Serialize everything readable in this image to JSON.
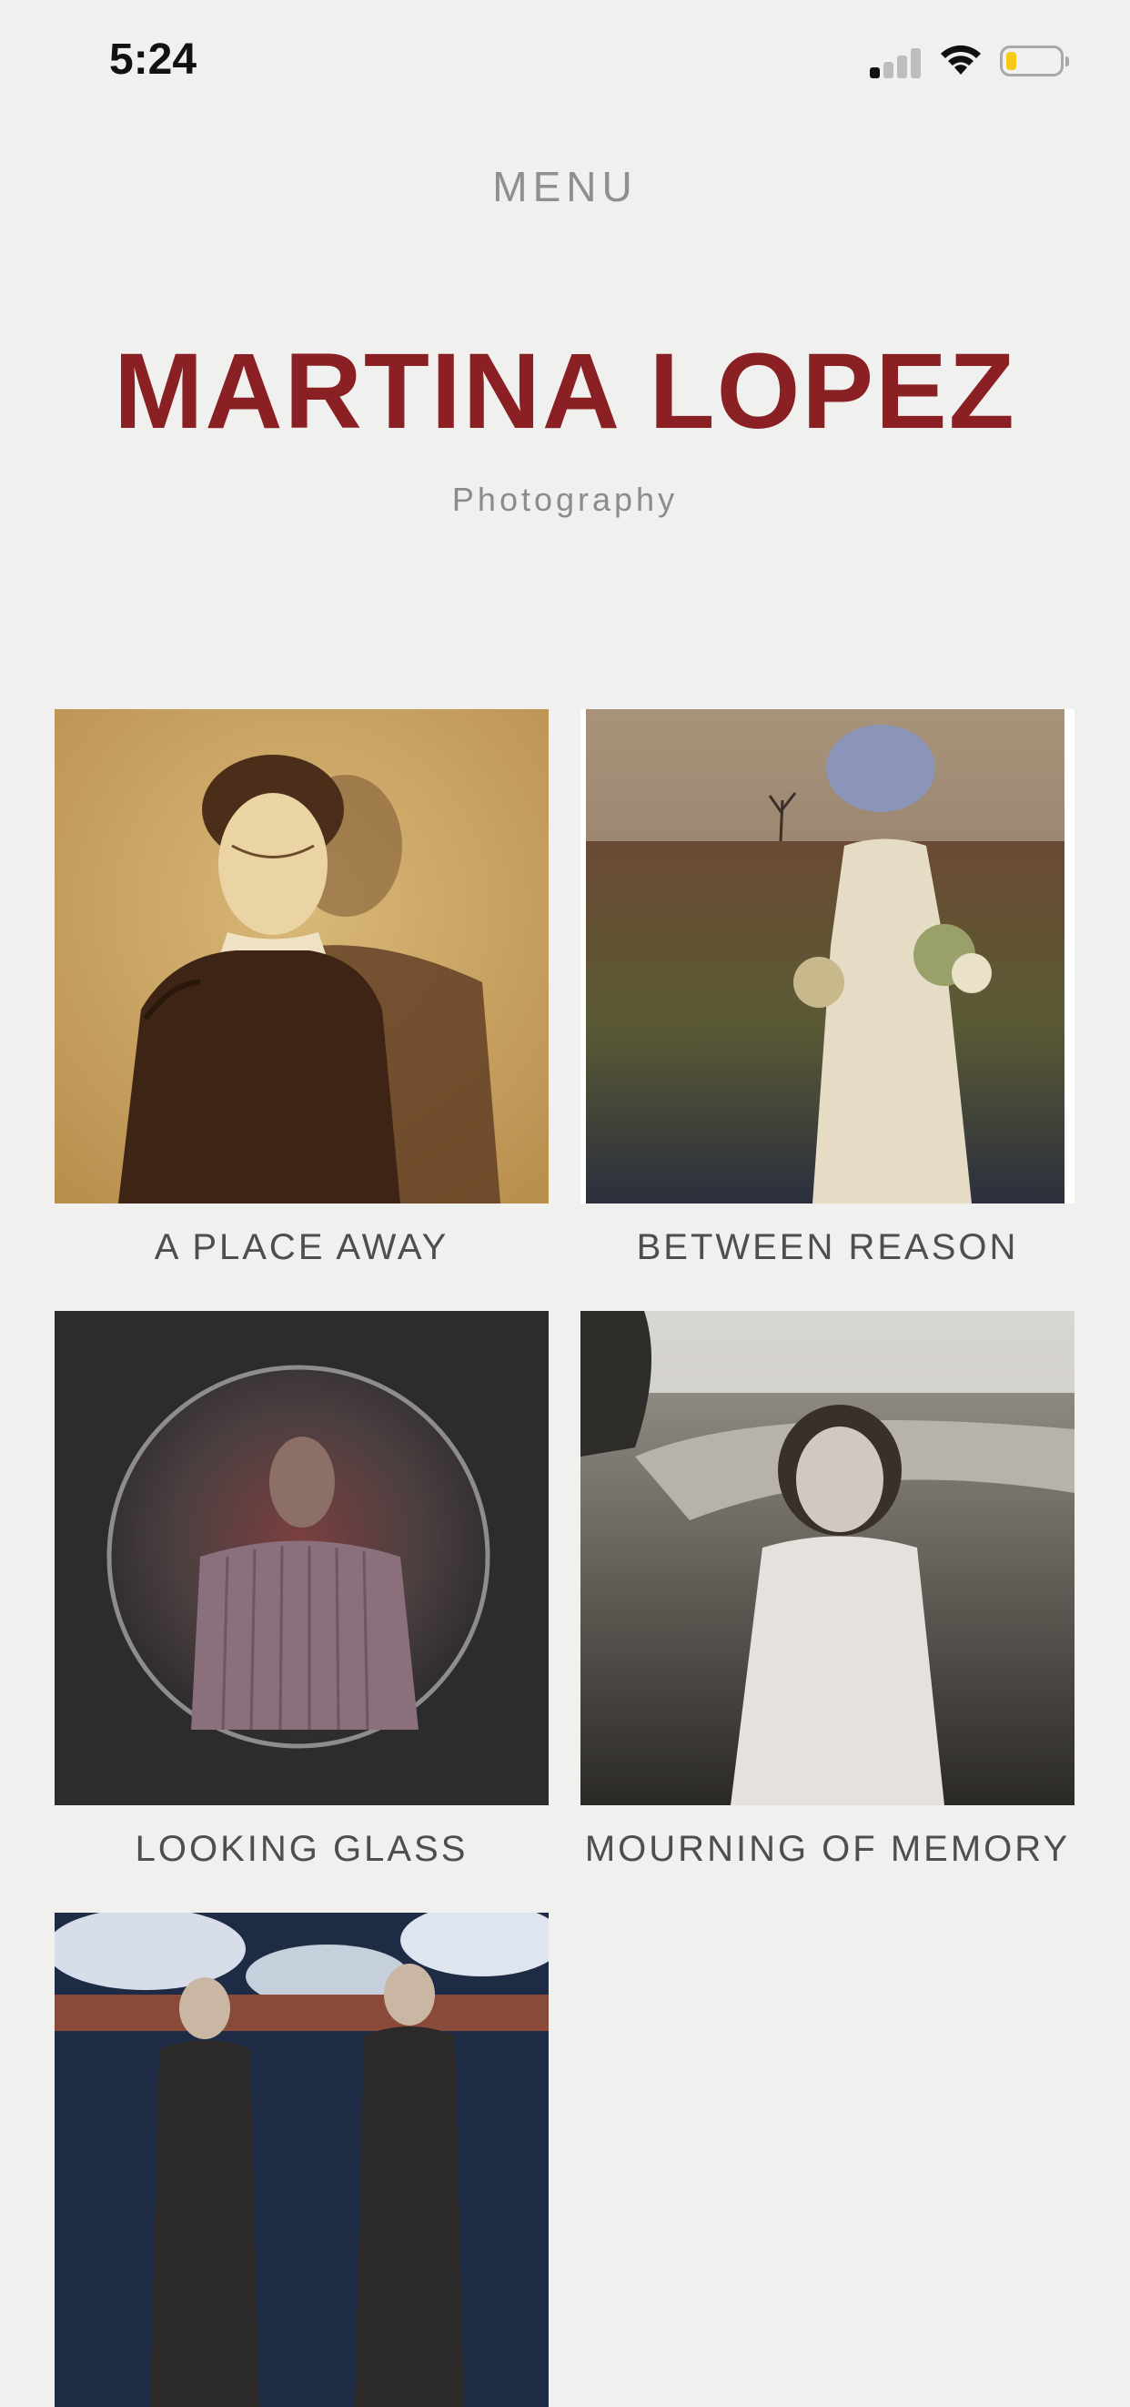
{
  "status_bar": {
    "time": "5:24"
  },
  "header": {
    "menu_label": "MENU",
    "title": "MARTINA LOPEZ",
    "subtitle": "Photography"
  },
  "gallery": {
    "items": [
      {
        "caption": "A PLACE AWAY"
      },
      {
        "caption": "BETWEEN REASON"
      },
      {
        "caption": "LOOKING GLASS"
      },
      {
        "caption": "MOURNING OF MEMORY"
      },
      {
        "caption": ""
      }
    ]
  },
  "colors": {
    "background": "#f0f0ef",
    "brand": "#8a2023",
    "menu_text": "#8f8f8f",
    "caption_text": "#4e4e4e"
  }
}
